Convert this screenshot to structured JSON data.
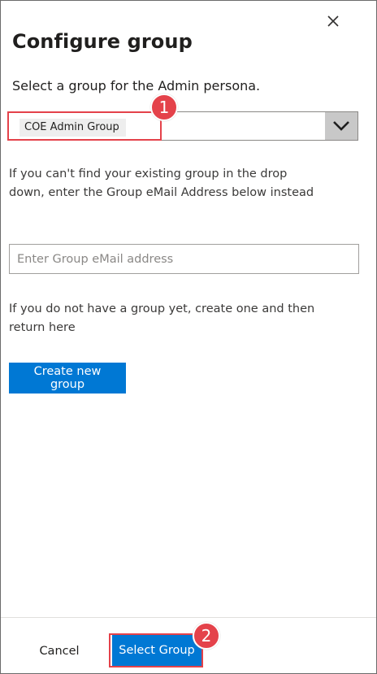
{
  "dialog": {
    "title": "Configure group",
    "subtitle": "Select a group for the Admin persona.",
    "close_icon": "close-icon"
  },
  "group_select": {
    "selected_value": "COE Admin Group",
    "dropdown_icon": "chevron-down-icon"
  },
  "help": {
    "email_hint": "If you can't find your existing group in the drop down, enter the Group eMail Address below instead",
    "create_hint": "If you do not have a group yet, create one and then return here"
  },
  "email_field": {
    "value": "",
    "placeholder": "Enter Group eMail address"
  },
  "create_button": {
    "label": "Create new group"
  },
  "footer": {
    "cancel_label": "Cancel",
    "select_label": "Select Group"
  },
  "callouts": [
    {
      "number": "1"
    },
    {
      "number": "2"
    }
  ],
  "colors": {
    "primary": "#0078d4",
    "callout": "#e4424a",
    "dropdown_button": "#c8c8c8"
  }
}
